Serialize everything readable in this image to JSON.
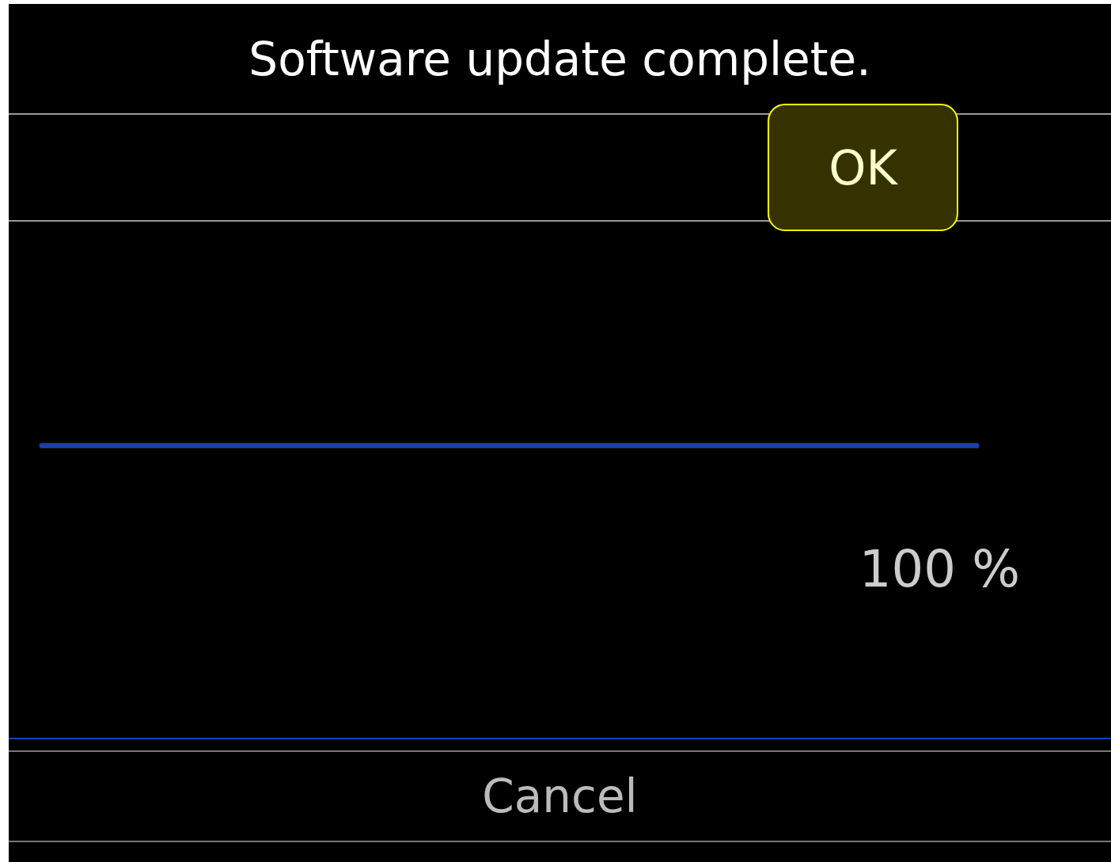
{
  "title": "Software update complete.",
  "buttons": [
    {
      "label": "OK",
      "selected": true
    },
    {
      "label": "Cancel",
      "selected": false
    }
  ],
  "progress": {
    "level": 1.0,
    "reading": "100 %"
  }
}
